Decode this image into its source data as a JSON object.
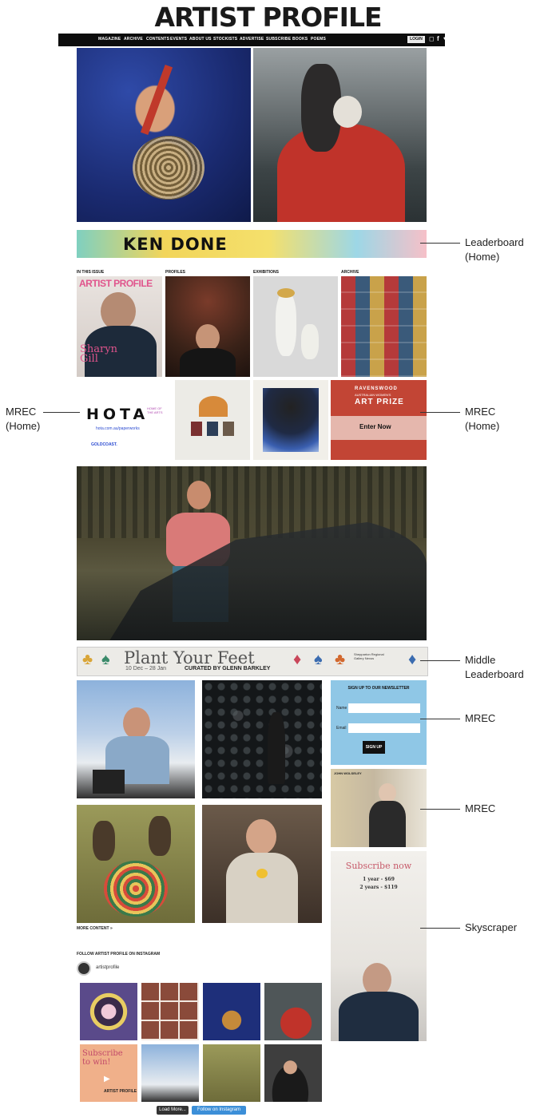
{
  "site": {
    "logo": "ARTIST PROFILE"
  },
  "nav": {
    "items": [
      "MAGAZINE",
      "ARCHIVE",
      "CONTENTS",
      "EVENTS",
      "ABOUT US",
      "STOCKISTS",
      "ADVERTISE",
      "SUBSCRIBE",
      "BOOKS",
      "POEMS"
    ],
    "login": "LOGIN",
    "icons": [
      "instagram-icon",
      "facebook-icon",
      "twitter-icon",
      "search-icon"
    ]
  },
  "leaderboard": {
    "text": "KEN DONE"
  },
  "sections": {
    "issue": "IN THIS ISSUE",
    "profiles": "PROFILES",
    "exhibitions": "EXHIBITIONS",
    "archive": "ARCHIVE"
  },
  "cover": {
    "title": "ARTIST PROFILE",
    "name": "Sharyn Gill"
  },
  "hota": {
    "logo": "HOTA",
    "tag": "HOME OF THE ARTS",
    "url": "hota.com.au/paperworks",
    "footer": "GOLDCOAST."
  },
  "ravenswood": {
    "line1": "RAVENSWOOD",
    "line2": "AUSTRALIAN WOMEN'S",
    "line3": "ART PRIZE",
    "button": "Enter Now"
  },
  "middle_leaderboard": {
    "title": "Plant Your Feet",
    "dates": "10 Dec – 28 Jan",
    "curated": "CURATED BY GLENN BARKLEY",
    "gallery": "Shepparton Regional Gallery Nexus"
  },
  "newsletter": {
    "title": "SIGN UP TO OUR NEWSLETTER",
    "name_label": "Name",
    "email_label": "Email",
    "button": "SIGN UP"
  },
  "mrec2": {
    "label": "JOHN WOLSELEY"
  },
  "skyscraper": {
    "title": "Subscribe now",
    "line1": "1 year - $69",
    "line2": "2 years - $119"
  },
  "more_content": "MORE CONTENT »",
  "instagram": {
    "title": "FOLLOW ARTIST PROFILE ON INSTAGRAM",
    "handle": "artistprofile",
    "tile5_text": "Subscribe to win!",
    "tile5_footer": "ARTIST PROFILE"
  },
  "footer_buttons": {
    "load_more": "Load More...",
    "follow": "Follow on Instagram"
  },
  "annotations": {
    "leaderboard_home": [
      "Leaderboard",
      "(Home)"
    ],
    "mrec_home_left": [
      "MREC",
      "(Home)"
    ],
    "mrec_home_right": [
      "MREC",
      "(Home)"
    ],
    "middle_leaderboard": [
      "Middle",
      "Leaderboard"
    ],
    "mrec_newsletter": "MREC",
    "mrec_second": "MREC",
    "skyscraper": "Skyscraper"
  }
}
